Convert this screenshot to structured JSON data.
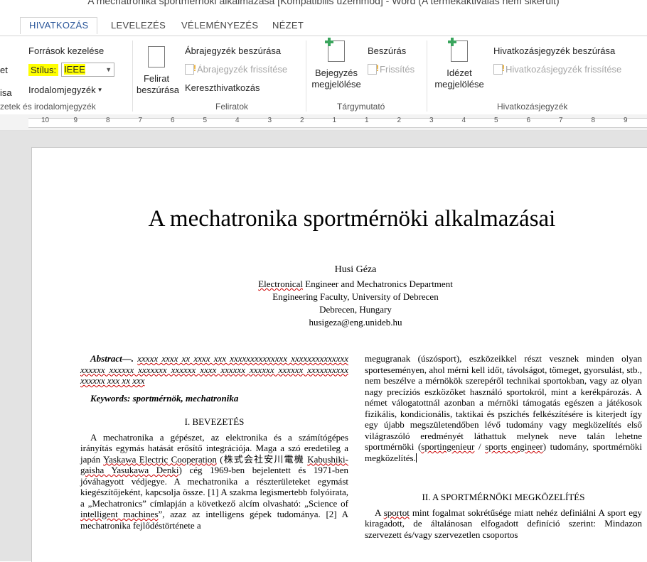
{
  "window": {
    "title": "A mechatronika sportmérnöki alkalmazása [Kompatibilis üzemmód] - Word (A termékaktiválás nem sikerült)"
  },
  "tabs": [
    "HIVATKOZÁS",
    "LEVELEZÉS",
    "VÉLEMÉNYEZÉS",
    "NÉZET"
  ],
  "ribbon": {
    "partial_left": {
      "a": "et",
      "b": "isa",
      "group": "zetek és irodalomjegyzék"
    },
    "citations": {
      "manage": "Források kezelése",
      "style_label": "Stílus:",
      "style_value": "IEEE",
      "bibliography": "Irodalomjegyzék"
    },
    "captions": {
      "insert_caption_1": "Felirat",
      "insert_caption_2": "beszúrása",
      "insert_tof": "Ábrajegyzék beszúrása",
      "update_table": "Ábrajegyzék frissítése",
      "cross_ref": "Kereszthivatkozás",
      "group": "Feliratok"
    },
    "index": {
      "mark_1": "Bejegyzés",
      "mark_2": "megjelölése",
      "insert": "Beszúrás",
      "update": "Frissítés",
      "group": "Tárgymutató"
    },
    "toa": {
      "mark_1": "Idézet",
      "mark_2": "megjelölése",
      "insert": "Hivatkozásjegyzék beszúrása",
      "update": "Hivatkozásjegyzék frissítése",
      "group": "Hivatkozásjegyzék"
    }
  },
  "ruler": {
    "labels": [
      "10",
      "9",
      "8",
      "7",
      "6",
      "5",
      "4",
      "3",
      "2",
      "1",
      "1",
      "2",
      "3",
      "4",
      "5",
      "6",
      "7",
      "8",
      "9"
    ]
  },
  "doc": {
    "title": "A mechatronika sportmérnöki alkalmazásai",
    "author": "Husi Géza",
    "affil1a": "Electronical",
    "affil1b": " Engineer and Mechatronics Department",
    "affil2": "Engineering Faculty, University of Debrecen",
    "affil3": "Debrecen, Hungary",
    "email": "husigeza@eng.unideb.hu",
    "abstract_label": "Abstract—.",
    "abstract_text": "xxxxx xxxx xx xxxx xxx xxxxxxxxxxxxxx xxxxxxxxxxxxxx xxxxxx xxxxxx xxxxxxx xxxxxx xxxx xxxxxx xxxxxx xxxxxx xxxxxxxxxx xxxxxx xxx xx xxx",
    "keywords": "Keywords: sportmérnök, mechatronika",
    "sec1": "I. BEVEZETÉS",
    "p1a": "A mechatronika a gépészet, az elektronika és a számítógépes irányítás egymás hatását erősítő integrációja. Maga a szó eredetileg a japán ",
    "p1b": "Yaskawa Electric Cooperation",
    "p1c": " (株式会社安川電機 ",
    "p1d": "Kabushiki-gaisha Yasukawa Denki",
    "p1e": ") cég 1969-ben bejelentett és 1971-ben jóváhagyott védjegye. A mechatronika a részterületeket egymást kiegészítőjeként, kapcsolja össze. [1] A szakma legismertebb folyóirata, a „Mechatronics” címlapján a következő alcím olvasható: „Science of ",
    "p1f": "intelligent machines",
    "p1g": "”, azaz az intelligens gépek tudománya. [2] A mechatronika fejlődéstörténete a",
    "c2a": "megugranak (úszósport), eszközeikkel részt vesznek minden olyan sporteseményen, ahol mérni kell időt, távolságot, tömeget, gyorsulást, stb., nem beszélve a mérnökök szerepéről technikai sportokban, vagy az olyan nagy precíziós eszközöket használó sportokról, mint a kerékpározás. A német válogatottnál azonban a mérnöki támogatás egészen a játékosok fizikális, kondicionális, taktikai és pszichés felkészítésére is kiterjedt így egy újabb megszületendőben lévő tudomány vagy megközelítés első világraszóló eredményét láthattuk melynek neve talán lehetne sportmérnöki (",
    "c2b": "sportingenieur",
    "c2c": " / ",
    "c2d": "sports engineer",
    "c2e": ") tudomány, sportmérnöki megközelítés.",
    "sec2": "II. A SPORTMÉRNÖKI MEGKÖZELÍTÉS",
    "p2a": "A ",
    "p2b": "sportot",
    "p2c": " mint fogalmat sokrétűsége miatt nehéz definiálni A sport egy kiragadott, de általánosan elfogadott definíció szerint: Mindazon szervezett és/vagy szervezetlen csoportos"
  }
}
